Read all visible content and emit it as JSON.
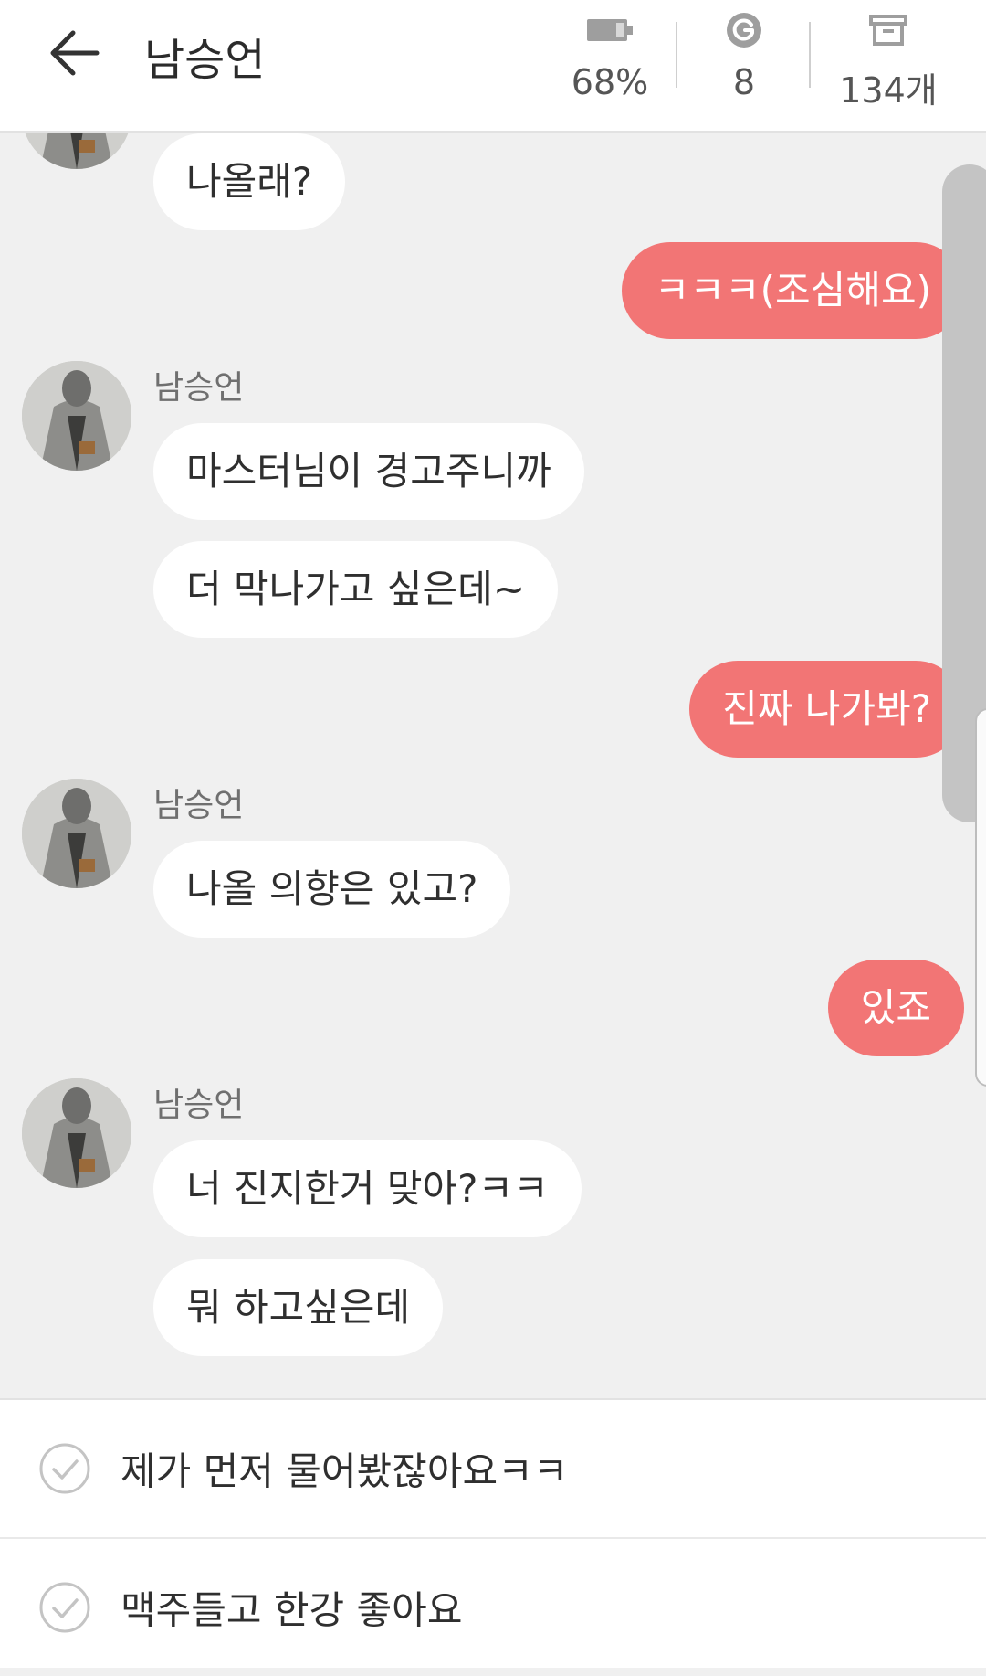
{
  "header": {
    "title": "남승언",
    "battery": "68%",
    "gems": "8",
    "items": "134개"
  },
  "accent_color": "#f27575",
  "messages": [
    {
      "from": "them",
      "text": "나올래?"
    },
    {
      "from": "me",
      "text": "ㅋㅋㅋ(조심해요)"
    },
    {
      "from": "them",
      "sender": "남승언",
      "text": "마스터님이 경고주니까"
    },
    {
      "from": "them",
      "text": "더 막나가고 싶은데~"
    },
    {
      "from": "me",
      "text": "진짜 나가봐?"
    },
    {
      "from": "them",
      "sender": "남승언",
      "text": "나올 의향은 있고?"
    },
    {
      "from": "me",
      "text": "있죠"
    },
    {
      "from": "them",
      "sender": "남승언",
      "text": "너 진지한거 맞아?ㅋㅋ"
    },
    {
      "from": "them",
      "text": "뭐 하고싶은데"
    }
  ],
  "suggestions": [
    "제가 먼저 물어봤잖아요ㅋㅋ",
    "맥주들고 한강 좋아요"
  ],
  "icons": {
    "back": "arrow-left-icon",
    "battery": "battery-icon",
    "gem": "g-coin-icon",
    "box": "archive-box-icon",
    "check": "check-circle-icon"
  }
}
